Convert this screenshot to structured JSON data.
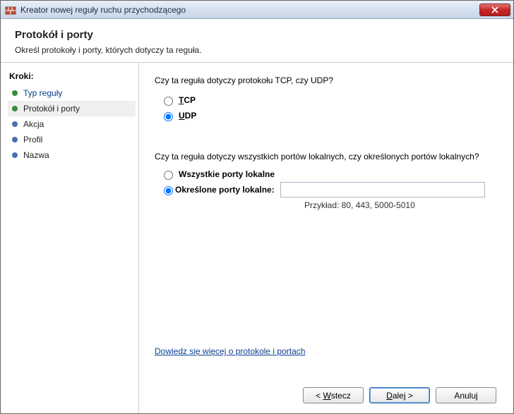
{
  "window": {
    "title": "Kreator nowej reguły ruchu przychodzącego"
  },
  "header": {
    "title": "Protokół i porty",
    "subtitle": "Określ protokoły i porty, których dotyczy ta reguła."
  },
  "sidebar": {
    "heading": "Kroki:",
    "items": [
      {
        "label": "Typ reguły",
        "state": "done",
        "link": true,
        "selected": false
      },
      {
        "label": "Protokół i porty",
        "state": "done",
        "link": false,
        "selected": true
      },
      {
        "label": "Akcja",
        "state": "pending",
        "link": false,
        "selected": false
      },
      {
        "label": "Profil",
        "state": "pending",
        "link": false,
        "selected": false
      },
      {
        "label": "Nazwa",
        "state": "pending",
        "link": false,
        "selected": false
      }
    ]
  },
  "main": {
    "q1": "Czy ta reguła dotyczy protokołu TCP, czy UDP?",
    "proto_tcp": {
      "prefix": "T",
      "rest": "CP"
    },
    "proto_udp": {
      "prefix": "U",
      "rest": "DP"
    },
    "q2": "Czy ta reguła dotyczy wszystkich portów lokalnych, czy określonych portów lokalnych?",
    "ports_all": "Wszystkie porty lokalne",
    "ports_specific_prefix": "O",
    "ports_specific_rest": "kreślone porty lokalne:",
    "ports_value": "",
    "example": "Przykład: 80, 443, 5000-5010",
    "learn_more": "Dowiedz się więcej o protokole i portach"
  },
  "buttons": {
    "back_prefix": "< ",
    "back_ul": "W",
    "back_rest": "stecz",
    "next_prefix": "",
    "next_ul": "D",
    "next_rest": "alej >",
    "cancel": "Anuluj"
  }
}
